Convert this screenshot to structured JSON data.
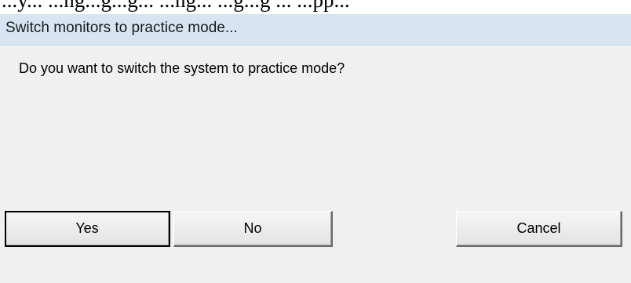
{
  "background_fragment": "...y... ...ng...g...g... ...ng... ...g...g ... ...pp...",
  "dialog": {
    "title": "Switch monitors to practice mode...",
    "message": "Do you want to switch the system to practice mode?",
    "buttons": {
      "yes": "Yes",
      "no": "No",
      "cancel": "Cancel"
    }
  },
  "colors": {
    "titlebar": "#d7e5f2",
    "dialog_background": "#f0f0f0",
    "button_border_dark": "#6b6b6b"
  }
}
